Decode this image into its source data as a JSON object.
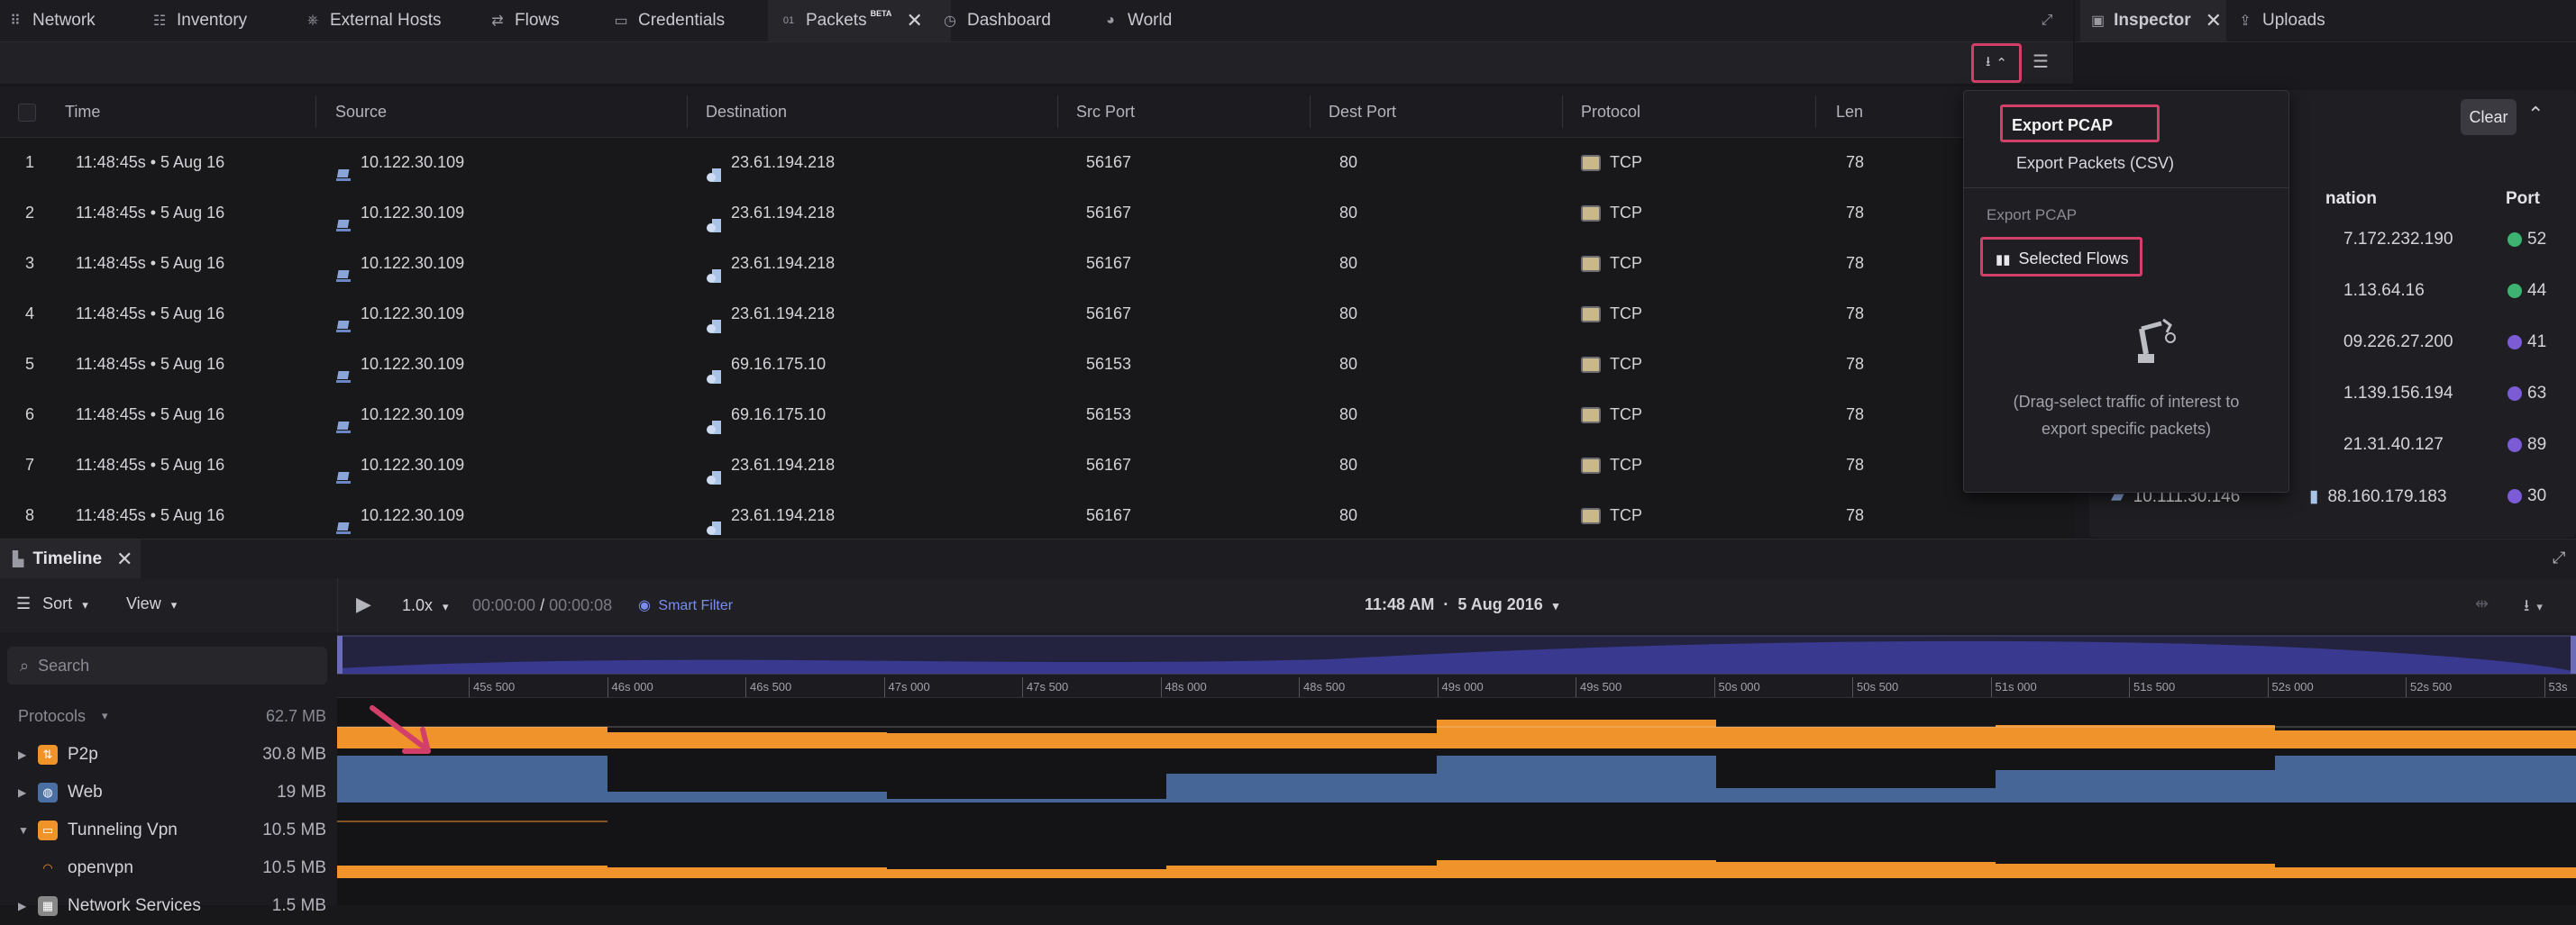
{
  "tabs": [
    {
      "label": "Network",
      "icon": "network-icon"
    },
    {
      "label": "Inventory",
      "icon": "inventory-icon"
    },
    {
      "label": "External Hosts",
      "icon": "external-hosts-icon"
    },
    {
      "label": "Flows",
      "icon": "flows-icon"
    },
    {
      "label": "Credentials",
      "icon": "credentials-icon"
    },
    {
      "label": "Packets",
      "icon": "packets-icon",
      "badge": "BETA",
      "active": true
    },
    {
      "label": "Dashboard",
      "icon": "dashboard-icon"
    },
    {
      "label": "World",
      "icon": "world-icon"
    }
  ],
  "right_tabs": [
    {
      "label": "Inspector",
      "icon": "inspector-icon",
      "active": true
    },
    {
      "label": "Uploads",
      "icon": "uploads-icon"
    }
  ],
  "table": {
    "columns": [
      "Time",
      "Source",
      "Destination",
      "Src Port",
      "Dest Port",
      "Protocol",
      "Len"
    ],
    "rows": [
      {
        "n": "1",
        "time": "11:48:45s • 5 Aug 16",
        "src": "10.122.30.109",
        "dst": "23.61.194.218",
        "sport": "56167",
        "dport": "80",
        "proto": "TCP",
        "len": "78"
      },
      {
        "n": "2",
        "time": "11:48:45s • 5 Aug 16",
        "src": "10.122.30.109",
        "dst": "23.61.194.218",
        "sport": "56167",
        "dport": "80",
        "proto": "TCP",
        "len": "78"
      },
      {
        "n": "3",
        "time": "11:48:45s • 5 Aug 16",
        "src": "10.122.30.109",
        "dst": "23.61.194.218",
        "sport": "56167",
        "dport": "80",
        "proto": "TCP",
        "len": "78"
      },
      {
        "n": "4",
        "time": "11:48:45s • 5 Aug 16",
        "src": "10.122.30.109",
        "dst": "23.61.194.218",
        "sport": "56167",
        "dport": "80",
        "proto": "TCP",
        "len": "78"
      },
      {
        "n": "5",
        "time": "11:48:45s • 5 Aug 16",
        "src": "10.122.30.109",
        "dst": "69.16.175.10",
        "sport": "56153",
        "dport": "80",
        "proto": "TCP",
        "len": "78"
      },
      {
        "n": "6",
        "time": "11:48:45s • 5 Aug 16",
        "src": "10.122.30.109",
        "dst": "69.16.175.10",
        "sport": "56153",
        "dport": "80",
        "proto": "TCP",
        "len": "78"
      },
      {
        "n": "7",
        "time": "11:48:45s • 5 Aug 16",
        "src": "10.122.30.109",
        "dst": "23.61.194.218",
        "sport": "56167",
        "dport": "80",
        "proto": "TCP",
        "len": "78"
      },
      {
        "n": "8",
        "time": "11:48:45s • 5 Aug 16",
        "src": "10.122.30.109",
        "dst": "23.61.194.218",
        "sport": "56167",
        "dport": "80",
        "proto": "TCP",
        "len": "78"
      }
    ]
  },
  "export_menu": {
    "export_pcap": "Export PCAP",
    "export_csv": "Export Packets (CSV)",
    "section_label": "Export PCAP",
    "selected_flows": "Selected Flows",
    "hint_line1": "(Drag-select traffic of interest to",
    "hint_line2": "export specific packets)"
  },
  "inspector": {
    "clear_label": "Clear",
    "columns": [
      "nation",
      "Port"
    ],
    "rows": [
      {
        "dst": "7.172.232.190",
        "port": "52"
      },
      {
        "dst": "1.13.64.16",
        "port": "44"
      },
      {
        "dst": "09.226.27.200",
        "port": "41"
      },
      {
        "dst": "1.139.156.194",
        "port": "63"
      },
      {
        "dst": "21.31.40.127",
        "port": "89"
      },
      {
        "src": "10.111.30.146",
        "dst": "88.160.179.183",
        "port": "30"
      }
    ]
  },
  "timeline": {
    "title": "Timeline",
    "sort_label": "Sort",
    "view_label": "View",
    "speed": "1.0x",
    "time_current": "00:00:00",
    "time_sep": "/",
    "time_total": "00:00:08",
    "smart_filter": "Smart Filter",
    "date_label": "11:48 AM  ·  5 Aug 2016",
    "search_placeholder": "Search",
    "ticks": [
      "45s 500",
      "46s 000",
      "46s 500",
      "47s 000",
      "47s 500",
      "48s 000",
      "48s 500",
      "49s 000",
      "49s 500",
      "50s 000",
      "50s 500",
      "51s 000",
      "51s 500",
      "52s 000",
      "52s 500",
      "53s"
    ],
    "protocols_header": "Protocols",
    "protocols_total": "62.7 MB",
    "protocols": [
      {
        "name": "P2p",
        "size": "30.8 MB",
        "color": "#f0932b",
        "expanded": false
      },
      {
        "name": "Web",
        "size": "19 MB",
        "color": "#4a6fa5",
        "expanded": false
      },
      {
        "name": "Tunneling Vpn",
        "size": "10.5 MB",
        "color": "#f0932b",
        "expanded": true
      },
      {
        "name": "openvpn",
        "size": "10.5 MB",
        "color": "#f0932b",
        "child": true
      },
      {
        "name": "Network Services",
        "size": "1.5 MB",
        "color": "#888888",
        "expanded": false
      }
    ]
  },
  "colors": {
    "accent": "#d2406a",
    "orange": "#f0932b",
    "blue": "#4a6fa5",
    "purple": "#3b3b8f"
  }
}
